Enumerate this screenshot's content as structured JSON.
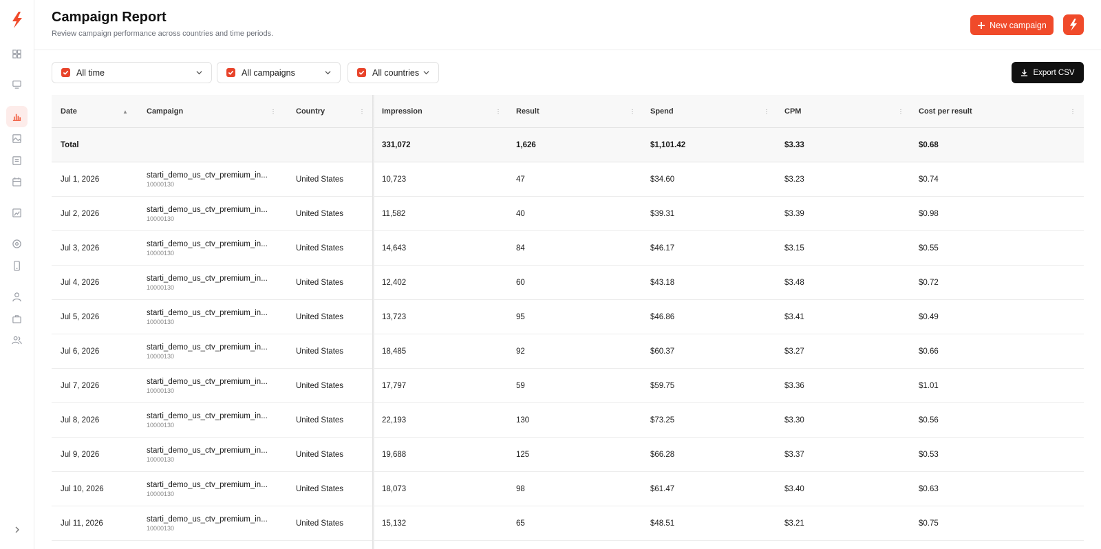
{
  "page": {
    "title": "Campaign Report",
    "subtitle": "Review campaign performance across countries and time periods."
  },
  "header": {
    "new_campaign_label": "New campaign"
  },
  "brand": {
    "accent": "#f04a2a"
  },
  "sidebar": {
    "icons": [
      "dashboard-icon",
      "monitor-icon",
      "chart-icon",
      "image-icon",
      "list-icon",
      "calendar-icon",
      "gallery-icon",
      "target-icon",
      "mobile-icon",
      "user-icon",
      "briefcase-icon",
      "users-icon"
    ],
    "active": "chart-icon"
  },
  "filters": [
    {
      "label": "All time",
      "checked": true
    },
    {
      "label": "All campaigns",
      "checked": true
    },
    {
      "label": "All countries",
      "checked": true
    }
  ],
  "export_label": "Export CSV",
  "table": {
    "columns": [
      "Date",
      "Campaign",
      "Country",
      "Impression",
      "Result",
      "Spend",
      "CPM",
      "Cost per result"
    ],
    "total": {
      "label": "Total",
      "impression": "331,072",
      "result": "1,626",
      "spend": "$1,101.42",
      "cpm": "$3.33",
      "cpr": "$0.68"
    },
    "rows": [
      {
        "date": "Jul 1, 2026",
        "campaign": "starti_demo_us_ctv_premium_in...",
        "campaign_id": "10000130",
        "country": "United States",
        "impression": "10,723",
        "result": "47",
        "spend": "$34.60",
        "cpm": "$3.23",
        "cpr": "$0.74"
      },
      {
        "date": "Jul 2, 2026",
        "campaign": "starti_demo_us_ctv_premium_in...",
        "campaign_id": "10000130",
        "country": "United States",
        "impression": "11,582",
        "result": "40",
        "spend": "$39.31",
        "cpm": "$3.39",
        "cpr": "$0.98"
      },
      {
        "date": "Jul 3, 2026",
        "campaign": "starti_demo_us_ctv_premium_in...",
        "campaign_id": "10000130",
        "country": "United States",
        "impression": "14,643",
        "result": "84",
        "spend": "$46.17",
        "cpm": "$3.15",
        "cpr": "$0.55"
      },
      {
        "date": "Jul 4, 2026",
        "campaign": "starti_demo_us_ctv_premium_in...",
        "campaign_id": "10000130",
        "country": "United States",
        "impression": "12,402",
        "result": "60",
        "spend": "$43.18",
        "cpm": "$3.48",
        "cpr": "$0.72"
      },
      {
        "date": "Jul 5, 2026",
        "campaign": "starti_demo_us_ctv_premium_in...",
        "campaign_id": "10000130",
        "country": "United States",
        "impression": "13,723",
        "result": "95",
        "spend": "$46.86",
        "cpm": "$3.41",
        "cpr": "$0.49"
      },
      {
        "date": "Jul 6, 2026",
        "campaign": "starti_demo_us_ctv_premium_in...",
        "campaign_id": "10000130",
        "country": "United States",
        "impression": "18,485",
        "result": "92",
        "spend": "$60.37",
        "cpm": "$3.27",
        "cpr": "$0.66"
      },
      {
        "date": "Jul 7, 2026",
        "campaign": "starti_demo_us_ctv_premium_in...",
        "campaign_id": "10000130",
        "country": "United States",
        "impression": "17,797",
        "result": "59",
        "spend": "$59.75",
        "cpm": "$3.36",
        "cpr": "$1.01"
      },
      {
        "date": "Jul 8, 2026",
        "campaign": "starti_demo_us_ctv_premium_in...",
        "campaign_id": "10000130",
        "country": "United States",
        "impression": "22,193",
        "result": "130",
        "spend": "$73.25",
        "cpm": "$3.30",
        "cpr": "$0.56"
      },
      {
        "date": "Jul 9, 2026",
        "campaign": "starti_demo_us_ctv_premium_in...",
        "campaign_id": "10000130",
        "country": "United States",
        "impression": "19,688",
        "result": "125",
        "spend": "$66.28",
        "cpm": "$3.37",
        "cpr": "$0.53"
      },
      {
        "date": "Jul 10, 2026",
        "campaign": "starti_demo_us_ctv_premium_in...",
        "campaign_id": "10000130",
        "country": "United States",
        "impression": "18,073",
        "result": "98",
        "spend": "$61.47",
        "cpm": "$3.40",
        "cpr": "$0.63"
      },
      {
        "date": "Jul 11, 2026",
        "campaign": "starti_demo_us_ctv_premium_in...",
        "campaign_id": "10000130",
        "country": "United States",
        "impression": "15,132",
        "result": "65",
        "spend": "$48.51",
        "cpm": "$3.21",
        "cpr": "$0.75"
      }
    ]
  }
}
